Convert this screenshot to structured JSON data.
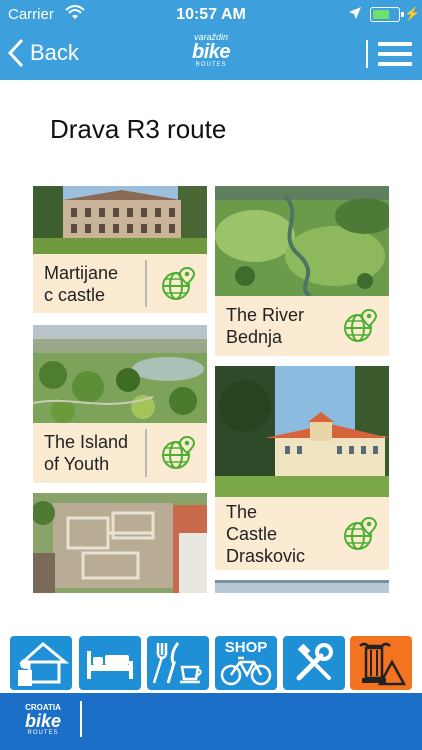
{
  "status_bar": {
    "carrier": "Carrier",
    "time": "10:57 AM",
    "battery_level": 0.7,
    "battery_color": "#6fe06b"
  },
  "nav": {
    "back_label": "Back",
    "logo_line1": "varaždin",
    "logo_line2": "bike",
    "logo_line3": "ROUTES",
    "menu_icon": "hamburger-menu-icon",
    "bar_color": "#3da0dc"
  },
  "page": {
    "title": "Drava R3 route"
  },
  "cards": [
    {
      "label": "Martijane\nc castle",
      "icon": "map-globe-icon"
    },
    {
      "label": "The River\nBednja",
      "icon": "map-globe-icon"
    },
    {
      "label": "The Island\nof Youth",
      "icon": "map-globe-icon"
    },
    {
      "label": "The\nCastle\nDraskovic",
      "icon": "map-globe-icon"
    },
    {
      "label": "",
      "icon": ""
    }
  ],
  "caption_color": "#faebd2",
  "categories": [
    {
      "name": "accommodation-tourism",
      "icon": "house-with-person-icon"
    },
    {
      "name": "accommodation",
      "icon": "bed-icon"
    },
    {
      "name": "food",
      "icon": "cutlery-cup-icon"
    },
    {
      "name": "shop",
      "label": "SHOP",
      "icon": "bicycle-icon"
    },
    {
      "name": "service",
      "icon": "tools-icon"
    },
    {
      "name": "culture",
      "icon": "column-mountain-icon"
    }
  ],
  "category_colors": {
    "default": "#1f8fd6",
    "culture": "#f37321"
  },
  "footer": {
    "logo_line1": "CROATIA",
    "logo_line2": "bike",
    "logo_line3": "ROUTES",
    "color": "#1c6fc6"
  }
}
